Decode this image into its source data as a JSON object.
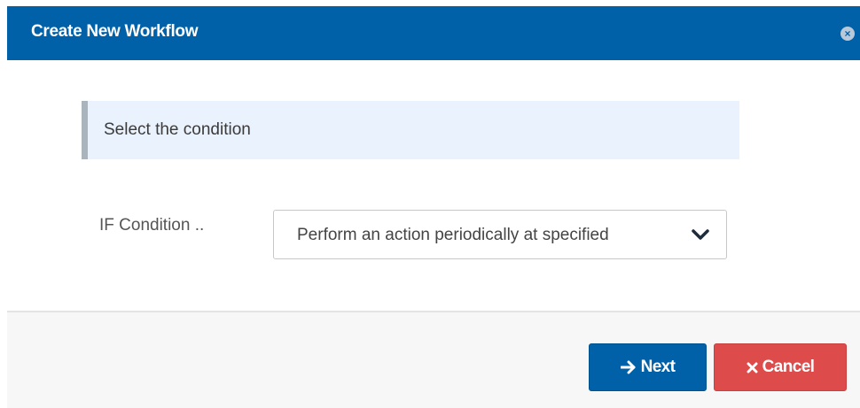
{
  "dialog": {
    "title": "Create New Workflow",
    "close_icon": "close-circle-icon",
    "info_text": "Select the condition",
    "condition_label": "IF Condition ..",
    "condition_selected": "Perform an action periodically at specified",
    "next_label": "Next",
    "next_icon": "arrow-right-icon",
    "cancel_label": "Cancel",
    "cancel_icon": "x-icon"
  },
  "colors": {
    "header_bg": "#0061a8",
    "next_bg": "#0061a8",
    "cancel_bg": "#dd4b4b",
    "info_bg": "#eaf2fd",
    "info_border": "#a9b4bd"
  }
}
